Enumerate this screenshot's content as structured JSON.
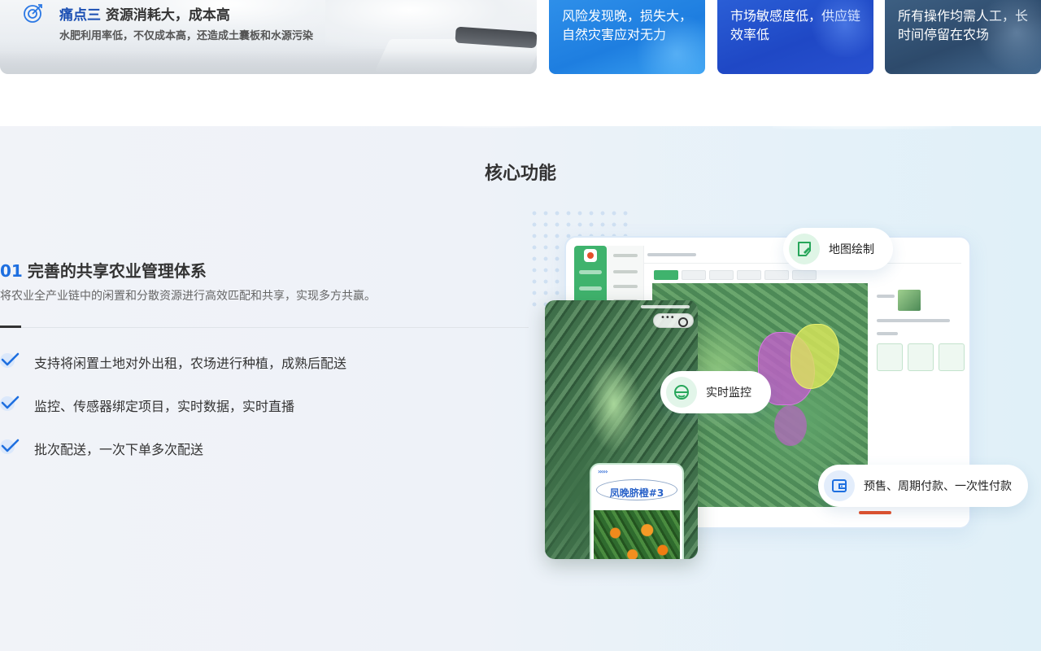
{
  "pain_points": {
    "main": {
      "number": "痛点三",
      "title": "资源消耗大，成本高",
      "description": "水肥利用率低，不仅成本高，还造成土囊板和水源污染"
    },
    "cards": [
      {
        "text": "风险发现晚，损失大，自然灾害应对无力"
      },
      {
        "text": "市场敏感度低，供应链效率低"
      },
      {
        "text": "所有操作均需人工，长时间停留在农场"
      }
    ]
  },
  "core": {
    "section_title": "核心功能",
    "feature": {
      "number": "01",
      "title": "完善的共享农业管理体系",
      "description": "将农业全产业链中的闲置和分散资源进行高效匹配和共享，实现多方共赢。",
      "bullets": [
        {
          "text": "支持将闲置土地对外出租，农场进行种植，成熟后配送"
        },
        {
          "text": "监控、传感器绑定项目，实时数据，实时直播"
        },
        {
          "text": "批次配送，一次下单多次配送"
        }
      ]
    },
    "badges": {
      "map_draw": "地图绘制",
      "live_monitor": "实时监控",
      "payment": "预售、周期付款、一次性付款"
    },
    "phone_card": {
      "arrows": "›››››",
      "product_name": "凤晚脐橙#3"
    }
  },
  "colors": {
    "accent_blue": "#1e6fe0",
    "pain_number": "#1b4fb3",
    "green": "#3fb36d"
  },
  "icons": [
    "target-icon",
    "check-icon",
    "map-draw-icon",
    "monitor-icon",
    "wallet-icon"
  ]
}
